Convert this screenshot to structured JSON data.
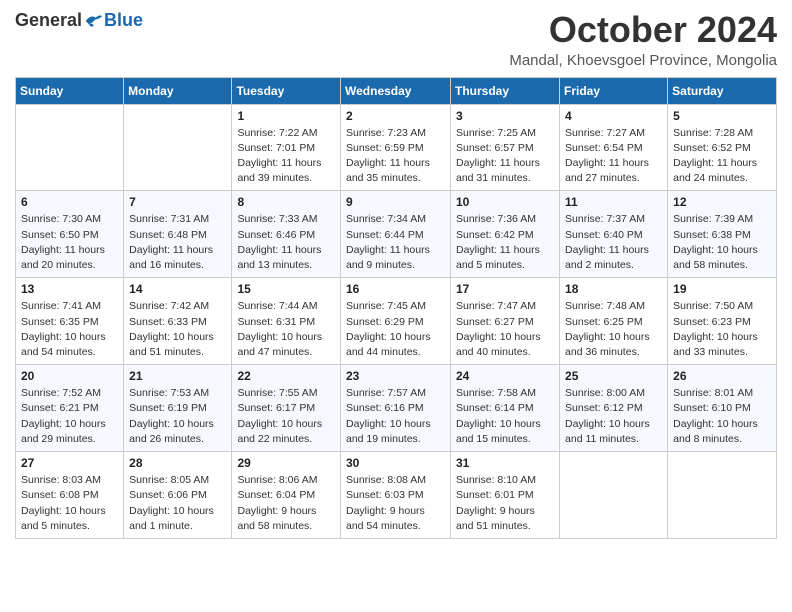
{
  "header": {
    "logo": {
      "general": "General",
      "blue": "Blue"
    },
    "title": "October 2024",
    "location": "Mandal, Khoevsgoel Province, Mongolia"
  },
  "weekdays": [
    "Sunday",
    "Monday",
    "Tuesday",
    "Wednesday",
    "Thursday",
    "Friday",
    "Saturday"
  ],
  "weeks": [
    [
      {
        "day": "",
        "info": ""
      },
      {
        "day": "",
        "info": ""
      },
      {
        "day": "1",
        "info": "Sunrise: 7:22 AM\nSunset: 7:01 PM\nDaylight: 11 hours and 39 minutes."
      },
      {
        "day": "2",
        "info": "Sunrise: 7:23 AM\nSunset: 6:59 PM\nDaylight: 11 hours and 35 minutes."
      },
      {
        "day": "3",
        "info": "Sunrise: 7:25 AM\nSunset: 6:57 PM\nDaylight: 11 hours and 31 minutes."
      },
      {
        "day": "4",
        "info": "Sunrise: 7:27 AM\nSunset: 6:54 PM\nDaylight: 11 hours and 27 minutes."
      },
      {
        "day": "5",
        "info": "Sunrise: 7:28 AM\nSunset: 6:52 PM\nDaylight: 11 hours and 24 minutes."
      }
    ],
    [
      {
        "day": "6",
        "info": "Sunrise: 7:30 AM\nSunset: 6:50 PM\nDaylight: 11 hours and 20 minutes."
      },
      {
        "day": "7",
        "info": "Sunrise: 7:31 AM\nSunset: 6:48 PM\nDaylight: 11 hours and 16 minutes."
      },
      {
        "day": "8",
        "info": "Sunrise: 7:33 AM\nSunset: 6:46 PM\nDaylight: 11 hours and 13 minutes."
      },
      {
        "day": "9",
        "info": "Sunrise: 7:34 AM\nSunset: 6:44 PM\nDaylight: 11 hours and 9 minutes."
      },
      {
        "day": "10",
        "info": "Sunrise: 7:36 AM\nSunset: 6:42 PM\nDaylight: 11 hours and 5 minutes."
      },
      {
        "day": "11",
        "info": "Sunrise: 7:37 AM\nSunset: 6:40 PM\nDaylight: 11 hours and 2 minutes."
      },
      {
        "day": "12",
        "info": "Sunrise: 7:39 AM\nSunset: 6:38 PM\nDaylight: 10 hours and 58 minutes."
      }
    ],
    [
      {
        "day": "13",
        "info": "Sunrise: 7:41 AM\nSunset: 6:35 PM\nDaylight: 10 hours and 54 minutes."
      },
      {
        "day": "14",
        "info": "Sunrise: 7:42 AM\nSunset: 6:33 PM\nDaylight: 10 hours and 51 minutes."
      },
      {
        "day": "15",
        "info": "Sunrise: 7:44 AM\nSunset: 6:31 PM\nDaylight: 10 hours and 47 minutes."
      },
      {
        "day": "16",
        "info": "Sunrise: 7:45 AM\nSunset: 6:29 PM\nDaylight: 10 hours and 44 minutes."
      },
      {
        "day": "17",
        "info": "Sunrise: 7:47 AM\nSunset: 6:27 PM\nDaylight: 10 hours and 40 minutes."
      },
      {
        "day": "18",
        "info": "Sunrise: 7:48 AM\nSunset: 6:25 PM\nDaylight: 10 hours and 36 minutes."
      },
      {
        "day": "19",
        "info": "Sunrise: 7:50 AM\nSunset: 6:23 PM\nDaylight: 10 hours and 33 minutes."
      }
    ],
    [
      {
        "day": "20",
        "info": "Sunrise: 7:52 AM\nSunset: 6:21 PM\nDaylight: 10 hours and 29 minutes."
      },
      {
        "day": "21",
        "info": "Sunrise: 7:53 AM\nSunset: 6:19 PM\nDaylight: 10 hours and 26 minutes."
      },
      {
        "day": "22",
        "info": "Sunrise: 7:55 AM\nSunset: 6:17 PM\nDaylight: 10 hours and 22 minutes."
      },
      {
        "day": "23",
        "info": "Sunrise: 7:57 AM\nSunset: 6:16 PM\nDaylight: 10 hours and 19 minutes."
      },
      {
        "day": "24",
        "info": "Sunrise: 7:58 AM\nSunset: 6:14 PM\nDaylight: 10 hours and 15 minutes."
      },
      {
        "day": "25",
        "info": "Sunrise: 8:00 AM\nSunset: 6:12 PM\nDaylight: 10 hours and 11 minutes."
      },
      {
        "day": "26",
        "info": "Sunrise: 8:01 AM\nSunset: 6:10 PM\nDaylight: 10 hours and 8 minutes."
      }
    ],
    [
      {
        "day": "27",
        "info": "Sunrise: 8:03 AM\nSunset: 6:08 PM\nDaylight: 10 hours and 5 minutes."
      },
      {
        "day": "28",
        "info": "Sunrise: 8:05 AM\nSunset: 6:06 PM\nDaylight: 10 hours and 1 minute."
      },
      {
        "day": "29",
        "info": "Sunrise: 8:06 AM\nSunset: 6:04 PM\nDaylight: 9 hours and 58 minutes."
      },
      {
        "day": "30",
        "info": "Sunrise: 8:08 AM\nSunset: 6:03 PM\nDaylight: 9 hours and 54 minutes."
      },
      {
        "day": "31",
        "info": "Sunrise: 8:10 AM\nSunset: 6:01 PM\nDaylight: 9 hours and 51 minutes."
      },
      {
        "day": "",
        "info": ""
      },
      {
        "day": "",
        "info": ""
      }
    ]
  ]
}
